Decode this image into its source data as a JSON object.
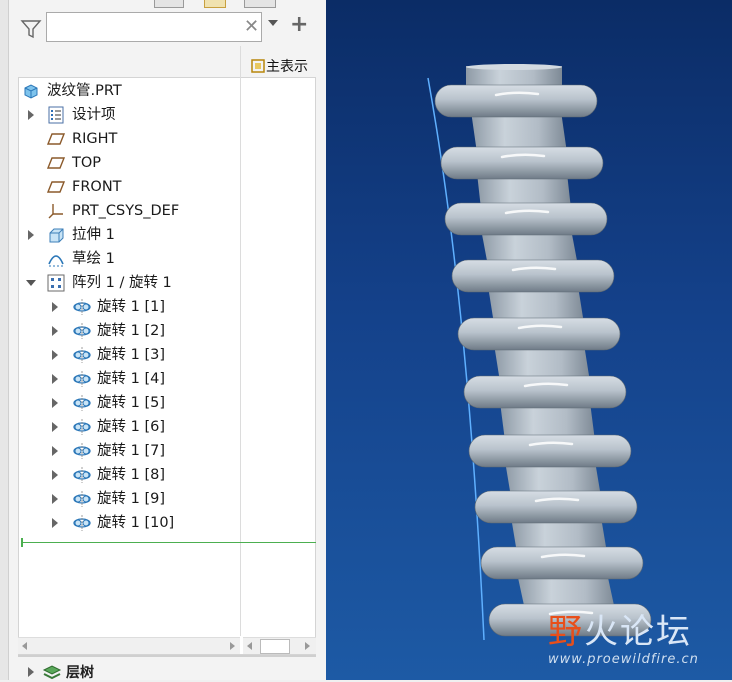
{
  "search": {
    "value": "",
    "placeholder": ""
  },
  "tree_header": {
    "display_column": "主表示"
  },
  "tree": [
    {
      "label": "波纹管.PRT",
      "icon": "part-icon",
      "expander": "none",
      "level": 0
    },
    {
      "label": "设计项",
      "icon": "design-items-icon",
      "expander": "collapsed",
      "level": 1
    },
    {
      "label": "RIGHT",
      "icon": "datum-plane-icon",
      "expander": "none",
      "level": 1
    },
    {
      "label": "TOP",
      "icon": "datum-plane-icon",
      "expander": "none",
      "level": 1
    },
    {
      "label": "FRONT",
      "icon": "datum-plane-icon",
      "expander": "none",
      "level": 1
    },
    {
      "label": "PRT_CSYS_DEF",
      "icon": "coordinate-system-icon",
      "expander": "none",
      "level": 1
    },
    {
      "label": "拉伸 1",
      "icon": "extrude-icon",
      "expander": "collapsed",
      "level": 1
    },
    {
      "label": "草绘 1",
      "icon": "sketch-icon",
      "expander": "none",
      "level": 1
    },
    {
      "label": "阵列 1 / 旋转 1",
      "icon": "pattern-icon",
      "expander": "expanded",
      "level": 1
    },
    {
      "label": "旋转 1 [1]",
      "icon": "revolve-icon",
      "expander": "collapsed",
      "level": 2
    },
    {
      "label": "旋转 1 [2]",
      "icon": "revolve-icon",
      "expander": "collapsed",
      "level": 2
    },
    {
      "label": "旋转 1 [3]",
      "icon": "revolve-icon",
      "expander": "collapsed",
      "level": 2
    },
    {
      "label": "旋转 1 [4]",
      "icon": "revolve-icon",
      "expander": "collapsed",
      "level": 2
    },
    {
      "label": "旋转 1 [5]",
      "icon": "revolve-icon",
      "expander": "collapsed",
      "level": 2
    },
    {
      "label": "旋转 1 [6]",
      "icon": "revolve-icon",
      "expander": "collapsed",
      "level": 2
    },
    {
      "label": "旋转 1 [7]",
      "icon": "revolve-icon",
      "expander": "collapsed",
      "level": 2
    },
    {
      "label": "旋转 1 [8]",
      "icon": "revolve-icon",
      "expander": "collapsed",
      "level": 2
    },
    {
      "label": "旋转 1 [9]",
      "icon": "revolve-icon",
      "expander": "collapsed",
      "level": 2
    },
    {
      "label": "旋转 1 [10]",
      "icon": "revolve-icon",
      "expander": "collapsed",
      "level": 2
    }
  ],
  "bottom_panel": {
    "layer_tree_label": "层树"
  },
  "watermark": {
    "title_first": "野",
    "title_rest": "火论坛",
    "url": "www.proewildfire.cn"
  },
  "colors": {
    "viewport_top": "#0b2c66",
    "viewport_bottom": "#1d5aa5",
    "model": "#b9c3cc",
    "insert_line": "#4caf50",
    "watermark_accent": "#e84f1a"
  }
}
